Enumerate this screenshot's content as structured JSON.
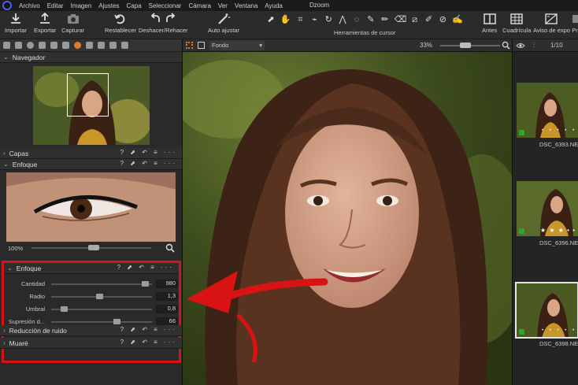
{
  "menubar": {
    "items": [
      "Archivo",
      "Editar",
      "Imagen",
      "Ajustes",
      "Capa",
      "Seleccionar",
      "Cámara",
      "Ver",
      "Ventana",
      "Ayuda"
    ],
    "window_title": "Dzoom"
  },
  "toolbar": {
    "importar": "Importar",
    "exportar": "Exportar",
    "capturar": "Capturar",
    "restablecer": "Restablecer",
    "deshacer_rehacer": "Deshacer/Rehacer",
    "auto_ajustar": "Auto ajustar",
    "herramientas_cursor": "Herramientas de cursor",
    "antes": "Antes",
    "cuadricula": "Cuadrícula",
    "aviso_expo": "Aviso de expo",
    "cut_label": "Pr"
  },
  "left": {
    "navegador": "Navegador",
    "capas": "Capas",
    "enfoque_top": "Enfoque",
    "zoom_pct": "100%",
    "panel_actions": "? ⬈ ↶ ≡ ···",
    "enfoque_panel": {
      "title": "Enfoque",
      "sliders": [
        {
          "label": "Cantidad",
          "value": "980",
          "level": 0.97
        },
        {
          "label": "Radio",
          "value": "1,3",
          "level": 0.48
        },
        {
          "label": "Umbral",
          "value": "0,8",
          "level": 0.1
        },
        {
          "label": "Supresión d...",
          "value": "66",
          "level": 0.66
        }
      ]
    },
    "reduccion_ruido": "Reducción de ruido",
    "muare": "Muaré"
  },
  "viewer": {
    "fondo": "Fondo",
    "zoom": "33%"
  },
  "browser": {
    "counter": "1/10",
    "thumbs": [
      {
        "name": "DSC_6393.NEF"
      },
      {
        "name": "DSC_6396.NEF"
      },
      {
        "name": "DSC_6398.NEF"
      }
    ]
  },
  "colors": {
    "accent_orange": "#e07a2b",
    "annotation_red": "#d71313",
    "badge_green": "#22aa33"
  }
}
